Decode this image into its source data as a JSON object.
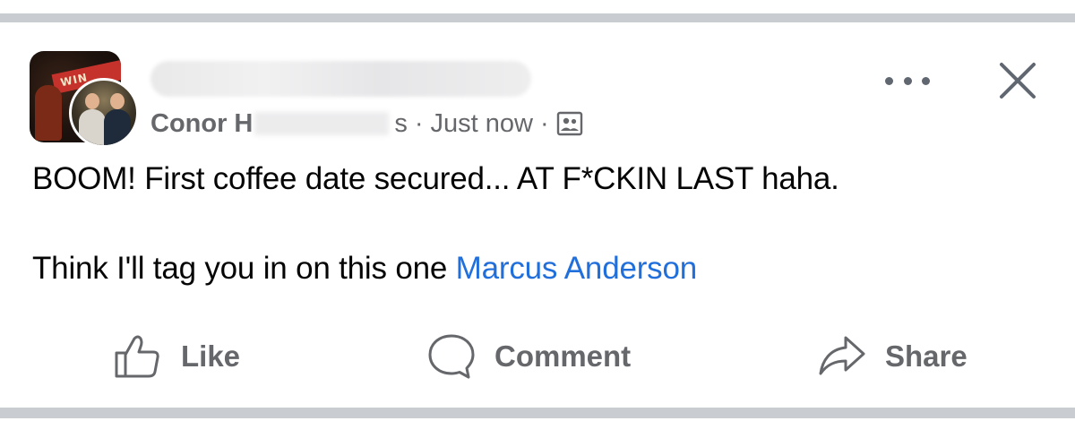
{
  "post": {
    "author_visible": "Conor H",
    "author_suffix_fragment": "s",
    "timestamp": "Just now",
    "separator": "·",
    "audience_icon": "group-members-icon",
    "group_avatar_banner_text": "WIN",
    "text_line1": "BOOM! First coffee date secured... AT F*CKIN LAST haha.",
    "text_line2_prefix": "Think I'll tag you in on this one ",
    "mention": "Marcus Anderson"
  },
  "header_actions": {
    "more_icon": "more-options-icon",
    "close_icon": "close-icon"
  },
  "actions": {
    "like_label": "Like",
    "comment_label": "Comment",
    "share_label": "Share"
  },
  "colors": {
    "text": "#050505",
    "secondary_text": "#65676b",
    "link": "#216fdb",
    "divider": "#c9ccd1"
  }
}
